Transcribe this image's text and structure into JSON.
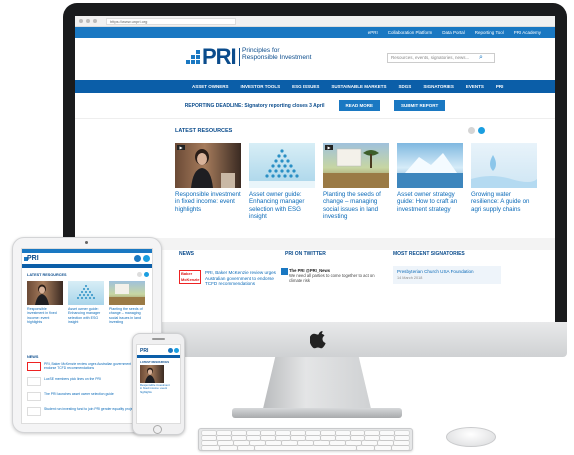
{
  "browser": {
    "url": "https://www.unpri.org"
  },
  "top_links": [
    "ePRI",
    "Collaboration Platform",
    "Data Portal",
    "Reporting Tool",
    "PRI Academy"
  ],
  "header": {
    "logo_mark": "PRI",
    "logo_text": "Principles for Responsible Investment",
    "search_placeholder": "Resources, events, signatories, news..."
  },
  "main_nav": [
    "ASSET OWNERS",
    "INVESTOR TOOLS",
    "ESG ISSUES",
    "SUSTAINABLE MARKETS",
    "SDGS",
    "SIGNATORIES",
    "EVENTS",
    "PRI"
  ],
  "deadline": {
    "text": "REPORTING DEADLINE: Signatory reporting closes 3 April",
    "read_more": "READ MORE",
    "submit": "SUBMIT REPORT"
  },
  "latest_resources": {
    "heading": "LATEST RESOURCES",
    "cards": [
      {
        "title": "Responsible investment in fixed income: event highlights",
        "tag": "▶"
      },
      {
        "title": "Asset owner guide: Enhancing manager selection with ESG insight",
        "tag": ""
      },
      {
        "title": "Planting the seeds of change – managing social issues in land investing",
        "tag": "▶"
      },
      {
        "title": "Asset owner strategy guide: How to craft an investment strategy",
        "tag": ""
      },
      {
        "title": "Growing water resilience: A guide on agri supply chains",
        "tag": ""
      }
    ]
  },
  "sections": {
    "news": "NEWS",
    "twitter": "PRI ON TWITTER",
    "signatories": "MOST RECENT SIGNATORIES"
  },
  "news_item": "PRI, Baker McKenzie review urges Australian government to endorse TCFD recommendations",
  "news_logo": "Baker McKenzie",
  "tweet": {
    "handle": "The PRI @PRI_News",
    "text": "We need all parties to come together to act on climate risk"
  },
  "signatory": {
    "name": "Presbyterian Church USA Foundation",
    "date": "14 March 2018"
  },
  "ipad": {
    "logo": "PRI",
    "heading": "LATEST RESOURCES",
    "cards": [
      "Responsible investment in fixed income: event highlights",
      "Asset owner guide: Enhancing manager selection with ESG insight",
      "Planting the seeds of change – managing social issues in land investing"
    ],
    "news_heading": "NEWS",
    "news": [
      "PRI, Baker McKenzie review urges Australian government to endorse TCFD recommendations",
      "LuxSE members pick lines on the PRI",
      "The PRI launches asset owner selection guide",
      "Student run investing fund to join PRI gender equality project"
    ]
  },
  "iphone": {
    "logo": "PRI",
    "heading": "LATEST RESOURCES",
    "card": "Responsible investment in fixed income: event highlights"
  },
  "colors": {
    "brand_dark": "#0b4c8c",
    "brand_blue": "#1a78c2",
    "nav_blue": "#0b5ea8",
    "accent": "#1a9ee0"
  }
}
